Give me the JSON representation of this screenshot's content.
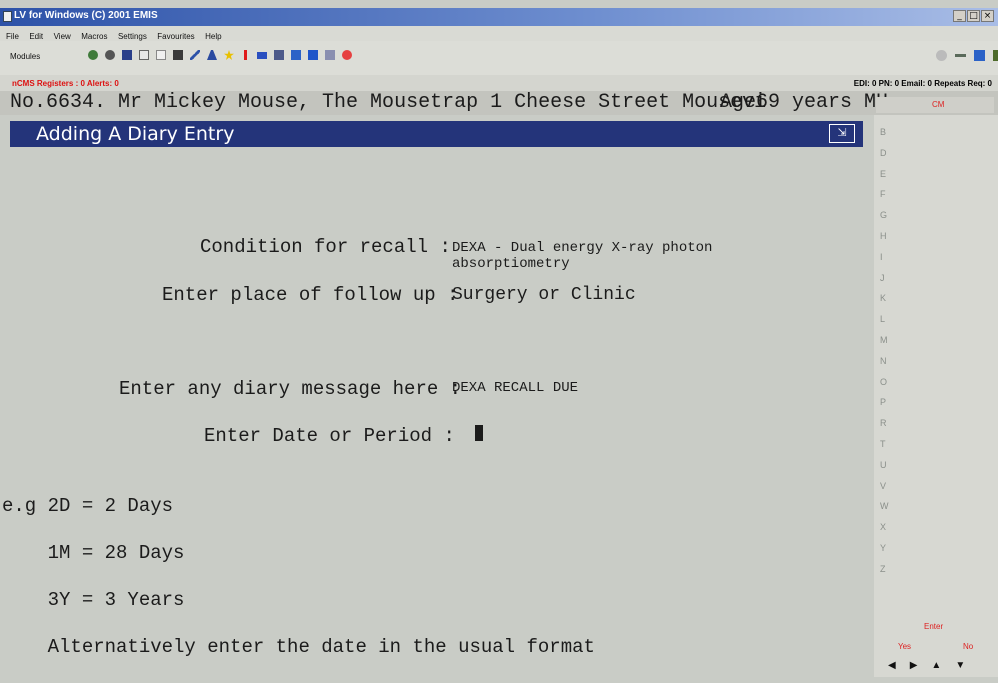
{
  "window": {
    "title": "LV for Windows (C) 2001 EMIS",
    "minimize": "_",
    "restore": "□",
    "close": "×"
  },
  "menu": [
    "File",
    "Edit",
    "View",
    "Macros",
    "Settings",
    "Favourites",
    "Help"
  ],
  "toolbar": {
    "modules_label": "Modules"
  },
  "status": {
    "registers_alerts": "nCMS Registers : 0  Alerts: 0",
    "counters": "EDI: 0  PN: 0  Email: 0  Repeats Req: 0"
  },
  "patient": {
    "summary": "No.6634. Mr Mickey Mouse, The Mousetrap 1 Cheese Street Mousevi",
    "age": "Age69 years MH"
  },
  "side_panel": {
    "cm_label": "CM",
    "letters": [
      "B",
      "D",
      "E",
      "F",
      "G",
      "H",
      "I",
      "J",
      "K",
      "L",
      "M",
      "N",
      "O",
      "P",
      "R",
      "T",
      "U",
      "V",
      "W",
      "X",
      "Y",
      "Z"
    ],
    "enter_label": "Enter",
    "yes_label": "Yes",
    "no_label": "No",
    "arrow_left": "◀",
    "arrow_right": "▶",
    "arrow_up": "▲",
    "arrow_down": "▼"
  },
  "form": {
    "banner_title": "Adding A Diary Entry",
    "banner_icon": "⇲",
    "condition_label": "Condition for recall :",
    "condition_value_line1": "DEXA - Dual energy X-ray photon",
    "condition_value_line2": "absorptiometry",
    "place_label": "Enter place of follow up :",
    "place_value": "Surgery or Clinic",
    "message_label": "Enter any diary message here :",
    "message_value": "DEXA RECALL DUE",
    "date_label": "Enter Date or Period :",
    "date_value": ""
  },
  "help_text": [
    "e.g 2D = 2 Days",
    "    1M = 28 Days",
    "    3Y = 3 Years",
    "    Alternatively enter the date in the usual format"
  ],
  "colors": {
    "banner_bg": "#24347a",
    "screen_bg": "#c9ccc6",
    "alert_red": "#d11111",
    "titlebar_blue": "#2d52a8"
  }
}
